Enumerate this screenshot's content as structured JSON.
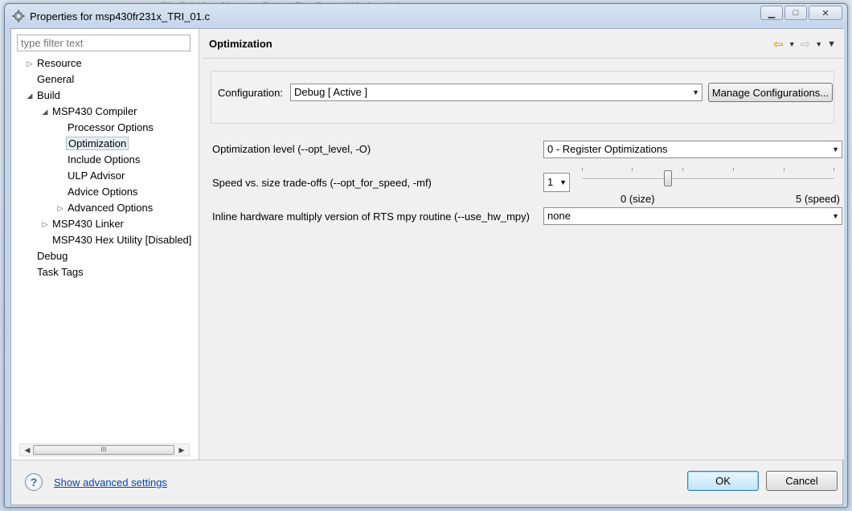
{
  "window": {
    "title": "Properties for msp430fr231x_TRI_01.c",
    "minimize_label": "▁",
    "maximize_label": "□",
    "close_label": "✕"
  },
  "background_menu": "File   Edit   View   Navigate   Project   Run   Scripts   Window   Help",
  "filter": {
    "placeholder": "type filter text"
  },
  "tree": [
    {
      "label": "Resource",
      "twisty": "▷"
    },
    {
      "label": "General",
      "twisty": ""
    },
    {
      "label": "Build",
      "twisty": "◢"
    },
    {
      "label": "MSP430 Compiler",
      "twisty": "◢"
    },
    {
      "label": "Processor Options",
      "twisty": ""
    },
    {
      "label": "Optimization",
      "twisty": "",
      "selected": true
    },
    {
      "label": "Include Options",
      "twisty": ""
    },
    {
      "label": "ULP Advisor",
      "twisty": ""
    },
    {
      "label": "Advice Options",
      "twisty": ""
    },
    {
      "label": "Advanced Options",
      "twisty": "▷"
    },
    {
      "label": "MSP430 Linker",
      "twisty": "▷"
    },
    {
      "label": "MSP430 Hex Utility  [Disabled]",
      "twisty": ""
    },
    {
      "label": "Debug",
      "twisty": ""
    },
    {
      "label": "Task Tags",
      "twisty": ""
    }
  ],
  "scrollbar": {
    "left": "◀",
    "right": "▶",
    "grip": "III"
  },
  "page": {
    "title": "Optimization",
    "nav": {
      "back": "⇦",
      "forward": "⇨",
      "dropdown": "▼"
    }
  },
  "configuration": {
    "label": "Configuration:",
    "value": "Debug  [ Active ]",
    "manage_button": "Manage Configurations..."
  },
  "options": {
    "opt_level": {
      "label": "Optimization level (--opt_level, -O)",
      "value": "0 - Register Optimizations"
    },
    "speed_size": {
      "label": "Speed vs. size trade-offs (--opt_for_speed, -mf)",
      "value": "1",
      "slider_level": 1,
      "slider_min_label": "0 (size)",
      "slider_max_label": "5 (speed)"
    },
    "hw_mpy": {
      "label": "Inline hardware multiply version of RTS mpy routine (--use_hw_mpy)",
      "value": "none"
    }
  },
  "bottom": {
    "help_glyph": "?",
    "advanced_link": "Show advanced settings",
    "ok_button": "OK",
    "cancel_button": "Cancel"
  },
  "colors": {
    "link": "#0645ad",
    "default_button_border": "#3c7fb1"
  }
}
